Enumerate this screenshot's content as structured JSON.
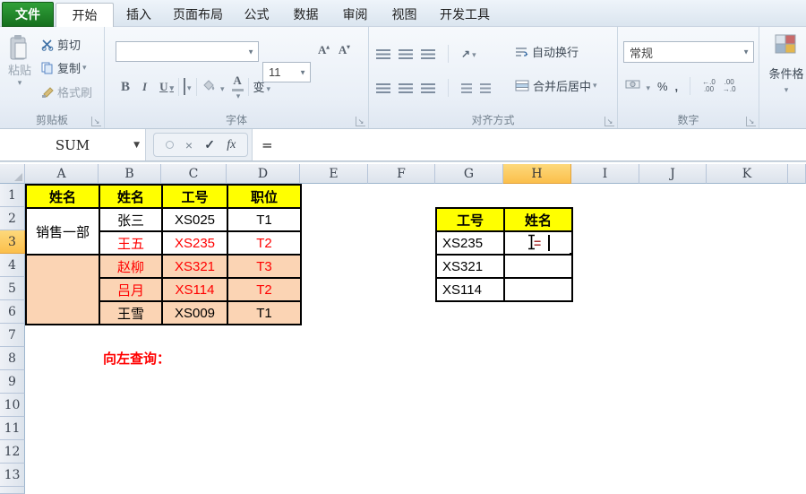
{
  "tabs": {
    "file": "文件",
    "items": [
      "开始",
      "插入",
      "页面布局",
      "公式",
      "数据",
      "审阅",
      "视图",
      "开发工具"
    ],
    "active": "开始"
  },
  "ribbon": {
    "clipboard": {
      "label": "剪贴板",
      "paste": "粘贴",
      "cut": "剪切",
      "copy": "复制",
      "format_painter": "格式刷"
    },
    "font": {
      "label": "字体",
      "font_name": "",
      "font_size": "11",
      "bold": "B",
      "italic": "I",
      "underline": "U",
      "grow": "A",
      "shrink": "A",
      "phonetic": "变"
    },
    "alignment": {
      "label": "对齐方式",
      "wrap_text": "自动换行",
      "merge_center": "合并后居中"
    },
    "number": {
      "label": "数字",
      "format": "常规",
      "percent": "%",
      "comma": ",",
      "increase_decimal": "←.0\n.00",
      "decrease_decimal": ".00\n→.0"
    },
    "conditional": {
      "label": "条件格"
    }
  },
  "formula_bar": {
    "name_box": "SUM",
    "cancel": "×",
    "enter": "✓",
    "fx": "fx",
    "content": "="
  },
  "sheet": {
    "columns": [
      "A",
      "B",
      "C",
      "D",
      "E",
      "F",
      "G",
      "H",
      "I",
      "J",
      "K"
    ],
    "selected_column": "H",
    "rows": [
      "1",
      "2",
      "3",
      "4",
      "5",
      "6",
      "7",
      "8",
      "9",
      "10",
      "11",
      "12",
      "13"
    ],
    "selected_row": "3",
    "left_table": {
      "headers": [
        "姓名",
        "姓名",
        "工号",
        "职位"
      ],
      "group_label": "销售一部",
      "rows": [
        {
          "name": "张三",
          "id": "XS025",
          "pos": "T1"
        },
        {
          "name": "王五",
          "id": "XS235",
          "pos": "T2"
        },
        {
          "name": "赵柳",
          "id": "XS321",
          "pos": "T3"
        },
        {
          "name": "吕月",
          "id": "XS114",
          "pos": "T2"
        },
        {
          "name": "王雪",
          "id": "XS009",
          "pos": "T1"
        }
      ]
    },
    "right_table": {
      "headers": [
        "工号",
        "姓名"
      ],
      "ids": [
        "XS235",
        "XS321",
        "XS114"
      ],
      "editing_value": "="
    },
    "note": "向左查询："
  },
  "colors": {
    "header_fill": "#FFFF00",
    "band_fill": "#FBD4B4",
    "text_red": "#FF0000",
    "file_tab_green": "#1F8C27",
    "selected_header": "#FBC34F"
  }
}
